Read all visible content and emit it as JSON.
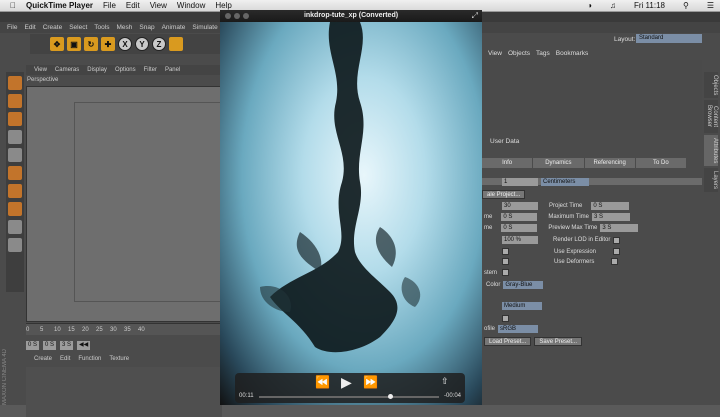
{
  "menubar": {
    "app": "QuickTime Player",
    "items": [
      "File",
      "Edit",
      "View",
      "Window",
      "Help"
    ],
    "clock": "Fri 11:18"
  },
  "c4d": {
    "menu": [
      "File",
      "Edit",
      "Create",
      "Select",
      "Tools",
      "Mesh",
      "Snap",
      "Animate",
      "Simulate"
    ],
    "axis_buttons": [
      "X",
      "Y",
      "Z"
    ],
    "viewport_menu": [
      "View",
      "Cameras",
      "Display",
      "Options",
      "Filter",
      "Panel"
    ],
    "viewport_label": "Perspective",
    "timeline_ticks": [
      "0",
      "5",
      "10",
      "15",
      "20",
      "25",
      "30",
      "35",
      "40"
    ],
    "frame_start": "0 S",
    "frame_value": "0 S",
    "frame_end": "3 S",
    "material_menu": [
      "Create",
      "Edit",
      "Function",
      "Texture"
    ],
    "brand": "MAXON CINEMA 4D",
    "layout_label": "Layout:",
    "layout_value": "Standard",
    "object_menu": [
      "View",
      "Objects",
      "Tags",
      "Bookmarks"
    ],
    "attr_menu_label": "User Data",
    "attr_tabs": [
      "Info",
      "Dynamics",
      "Referencing",
      "To Do"
    ],
    "attributes": {
      "scale_value": "1",
      "scale_unit": "Centimeters",
      "scale_project_btn": "ale Project...",
      "fps_value": "30",
      "project_time_label": "Project Time",
      "project_time": "0 S",
      "min_label": "me",
      "min_value": "0 S",
      "maximum_time_label": "Maximum Time",
      "maximum_time": "3 S",
      "preview_min_label": "me",
      "preview_min": "0 S",
      "preview_max_label": "Preview Max Time",
      "preview_max": "3 S",
      "lod_value": "100 %",
      "render_lod_label": "Render LOD in Editor",
      "use_expression_label": "Use Expression",
      "use_deformers_label": "Use Deformers",
      "stem_label": "stem",
      "color_label": "Color",
      "color_value": "Gray-Blue",
      "medium_value": "Medium",
      "profile_label": "ofile",
      "profile_value": "sRGB",
      "load_preset_btn": "Load Preset...",
      "save_preset_btn": "Save Preset..."
    },
    "right_tabs": [
      "Objects",
      "Content Browser",
      "Attributes",
      "Layers"
    ]
  },
  "quicktime": {
    "title": "inkdrop-tute_xp (Converted)",
    "time_elapsed": "00:11",
    "time_remaining": "-00:04",
    "progress": 0.73
  }
}
